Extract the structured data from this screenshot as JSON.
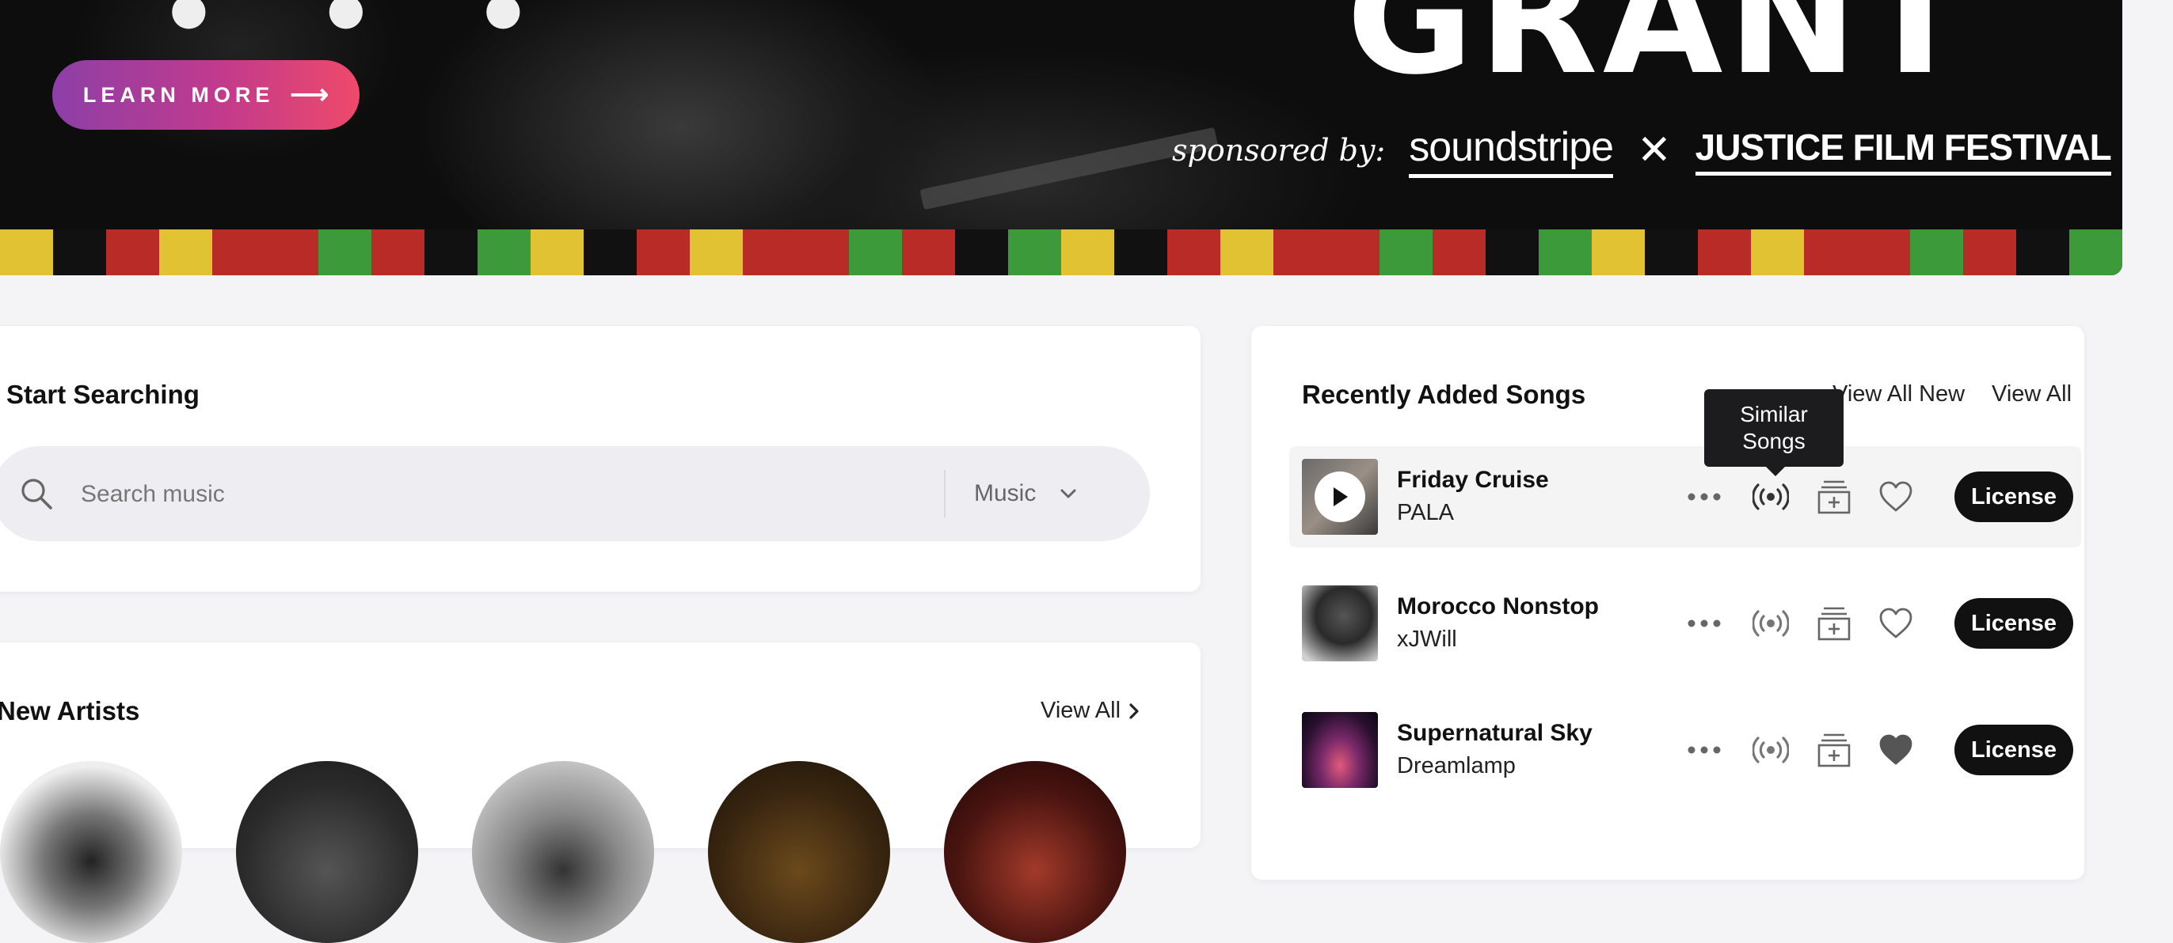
{
  "hero": {
    "title": "GRANT",
    "learn_more_label": "LEARN MORE",
    "learn_more_arrow": "⟶",
    "sponsored_by": "sponsored by:",
    "sponsor_1": "soundstripe",
    "sponsor_sep": "✕",
    "sponsor_2": "JUSTICE FILM FESTIVAL",
    "stripe_colors": [
      "#e1c233",
      "#111111",
      "#b82b26",
      "#3c9a3a",
      "#111111",
      "#e1c233",
      "#b82b26",
      "#111111",
      "#3c9a3a",
      "#e1c233"
    ]
  },
  "search": {
    "heading": "Start Searching",
    "placeholder": "Search music",
    "type_label": "Music"
  },
  "artists": {
    "heading": "New Artists",
    "view_all": "View All"
  },
  "songs": {
    "heading": "Recently Added Songs",
    "view_all_new": "View All New",
    "view_all": "View All",
    "tooltip": [
      "Similar",
      "Songs"
    ],
    "license_label": "License",
    "items": [
      {
        "title": "Friday Cruise",
        "artist": "PALA",
        "liked": false
      },
      {
        "title": "Morocco Nonstop",
        "artist": "xJWill",
        "liked": false
      },
      {
        "title": "Supernatural Sky",
        "artist": "Dreamlamp",
        "liked": true
      }
    ]
  }
}
